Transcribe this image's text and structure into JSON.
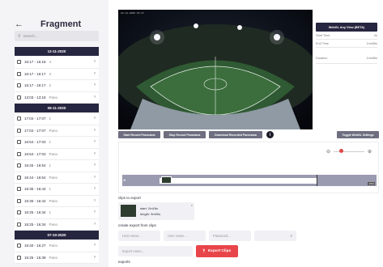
{
  "sidebar": {
    "title": "Fragment",
    "back_icon": "arrow-left-icon",
    "search_placeholder": "Search...",
    "groups": [
      {
        "date": "12-11-2020",
        "items": [
          {
            "time": "16:17 - 16:18",
            "count": "4"
          },
          {
            "time": "16:17 - 16:17",
            "count": "3"
          },
          {
            "time": "16:17 - 16:17",
            "count": "2"
          },
          {
            "time": "13:03 - 13:18",
            "count": "Pano"
          }
        ]
      },
      {
        "date": "06-11-2020",
        "items": [
          {
            "time": "17:04 - 17:07",
            "count": "1"
          },
          {
            "time": "17:04 - 17:07",
            "count": "Pano"
          },
          {
            "time": "16:54 - 17:03",
            "count": "1"
          },
          {
            "time": "16:54 - 17:03",
            "count": "Pano"
          },
          {
            "time": "16:45 - 16:54",
            "count": "1"
          },
          {
            "time": "16:44 - 16:54",
            "count": "Pano"
          },
          {
            "time": "16:35 - 16:44",
            "count": "1"
          },
          {
            "time": "16:35 - 16:44",
            "count": "Pano"
          },
          {
            "time": "16:25 - 16:34",
            "count": "1"
          },
          {
            "time": "16:25 - 16:34",
            "count": "Pano"
          }
        ]
      },
      {
        "date": "07-10-2020",
        "items": [
          {
            "time": "15:40 - 16:27",
            "count": "Pano"
          },
          {
            "time": "15:25 - 15:39",
            "count": "Pano"
          }
        ]
      }
    ]
  },
  "video": {
    "overlay_text": "12-11-2020 16:17"
  },
  "info": {
    "webgl_button": "WebGL Any View (BETA)",
    "start_time_label": "Start Time",
    "start_time_value": "0s",
    "end_time_label": "End Time",
    "end_time_value": "1hm56s",
    "duration_label": "Duration",
    "duration_value": "1hm56s"
  },
  "toolbar": {
    "start_record": "Start Record Panorama",
    "stop_record": "Stop Record Panorama",
    "download_record": "Download Recorded Panorama",
    "info_icon": "i",
    "toggle_webgl": "Toggle WebGL Settings"
  },
  "timeline": {
    "zoom_out_icon": "zoom-out-icon",
    "zoom_in_icon": "zoom-in-icon",
    "zoom_level": 0.25,
    "end_label": "1h01"
  },
  "clips": {
    "title": "clips to export",
    "items": [
      {
        "start": "start: 2m16s",
        "length": "length: 9m00s"
      }
    ]
  },
  "create_export": {
    "title": "create export from clips",
    "host_placeholder": "Host name...",
    "user_placeholder": "User name...",
    "password_placeholder": "Password...",
    "port_value": "0",
    "export_name_placeholder": "Export name...",
    "export_button": "Export Clips"
  },
  "exports": {
    "title": "exports"
  },
  "colors": {
    "primary_dark": "#262640",
    "accent_red": "#e8454a",
    "button_gray": "#6e6e80"
  }
}
